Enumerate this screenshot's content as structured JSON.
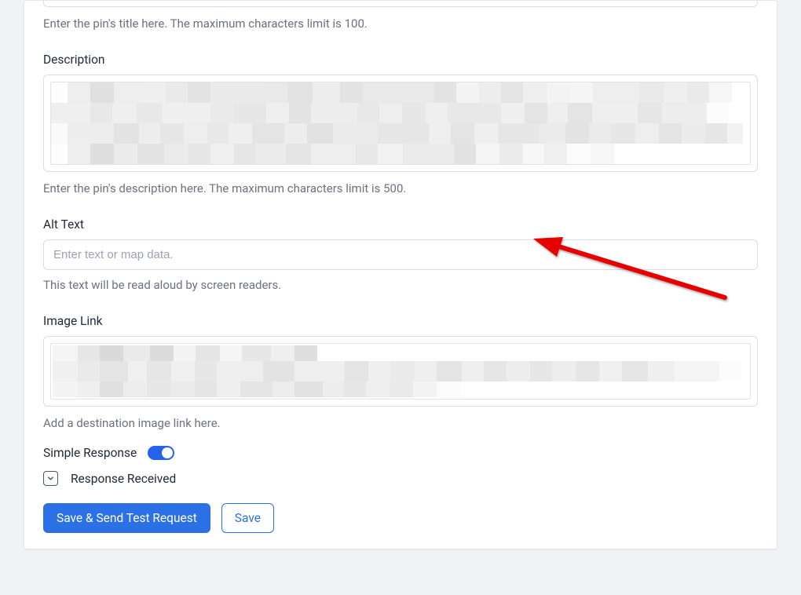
{
  "title_section": {
    "helper": "Enter the pin's title here. The maximum characters limit is 100."
  },
  "description_section": {
    "label": "Description",
    "helper": "Enter the pin's description here. The maximum characters limit is 500."
  },
  "alt_text_section": {
    "label": "Alt Text",
    "placeholder": "Enter text or map data.",
    "helper": "This text will be read aloud by screen readers."
  },
  "image_link_section": {
    "label": "Image Link",
    "helper": "Add a destination image link here."
  },
  "response": {
    "simple_label": "Simple Response",
    "received_label": "Response Received"
  },
  "buttons": {
    "save_send": "Save & Send Test Request",
    "save": "Save"
  }
}
